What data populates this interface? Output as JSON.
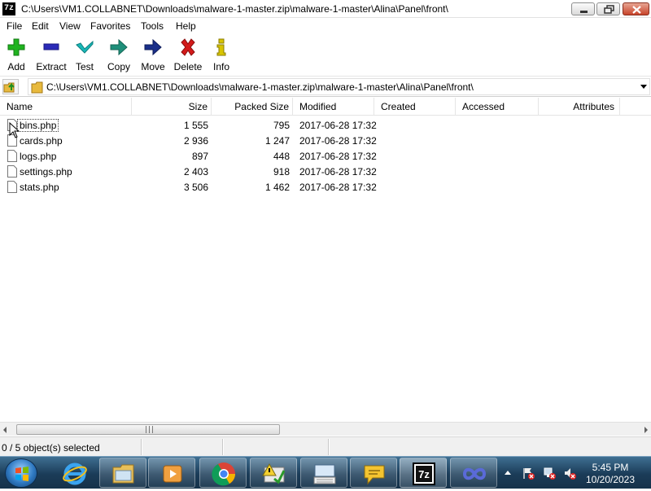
{
  "window": {
    "title": "C:\\Users\\VM1.COLLABNET\\Downloads\\malware-1-master.zip\\malware-1-master\\Alina\\Panel\\front\\",
    "logo_text": "7z"
  },
  "menu": [
    "File",
    "Edit",
    "View",
    "Favorites",
    "Tools",
    "Help"
  ],
  "toolbar": {
    "add": "Add",
    "extract": "Extract",
    "test": "Test",
    "copy": "Copy",
    "move": "Move",
    "delete": "Delete",
    "info": "Info"
  },
  "address": {
    "path": "C:\\Users\\VM1.COLLABNET\\Downloads\\malware-1-master.zip\\malware-1-master\\Alina\\Panel\\front\\"
  },
  "columns": {
    "name": "Name",
    "size": "Size",
    "packed": "Packed Size",
    "modified": "Modified",
    "created": "Created",
    "accessed": "Accessed",
    "attributes": "Attributes"
  },
  "files": [
    {
      "name": "bins.php",
      "size": "1 555",
      "packed": "795",
      "modified": "2017-06-28 17:32"
    },
    {
      "name": "cards.php",
      "size": "2 936",
      "packed": "1 247",
      "modified": "2017-06-28 17:32"
    },
    {
      "name": "logs.php",
      "size": "897",
      "packed": "448",
      "modified": "2017-06-28 17:32"
    },
    {
      "name": "settings.php",
      "size": "2 403",
      "packed": "918",
      "modified": "2017-06-28 17:32"
    },
    {
      "name": "stats.php",
      "size": "3 506",
      "packed": "1 462",
      "modified": "2017-06-28 17:32"
    }
  ],
  "status": {
    "selection": "0 / 5 object(s) selected"
  },
  "taskbar": {
    "apps": [
      "internet-explorer-icon",
      "file-explorer-icon",
      "media-player-icon",
      "chrome-icon",
      "warning-app-icon",
      "keyboard-app-icon",
      "chat-bubble-icon",
      "7zip-icon",
      "infinity-app-icon"
    ],
    "taskbar_7z_label": "7z",
    "time": "5:45 PM",
    "date": "10/20/2023"
  },
  "colors": {
    "add": "#1fb31f",
    "extract": "#2b2bb8",
    "test": "#18b8b8",
    "copy": "#1f8f7a",
    "move": "#1a2f8a",
    "delete": "#d31a1a",
    "info": "#d8c400",
    "folder": "#e8b93c"
  }
}
